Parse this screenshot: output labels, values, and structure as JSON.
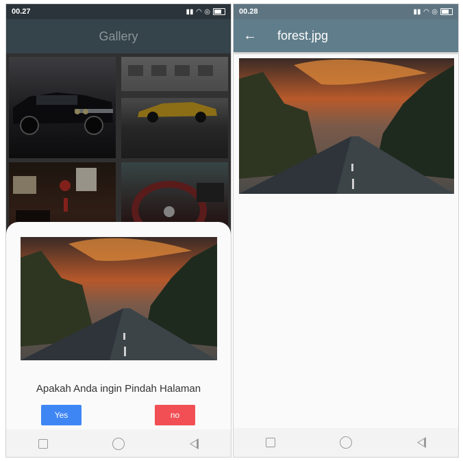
{
  "left_screen": {
    "status": {
      "time": "00.27"
    },
    "appbar": {
      "title": "Gallery"
    },
    "gallery": {
      "tiles": [
        {
          "name": "car-black"
        },
        {
          "name": "car-yellow"
        },
        {
          "name": "street-night"
        },
        {
          "name": "steering-wheel"
        }
      ]
    },
    "dialog": {
      "question": "Apakah Anda ingin Pindah Halaman",
      "yes_label": "Yes",
      "no_label": "no",
      "yes_color": "#3f86f5",
      "no_color": "#f24f55"
    }
  },
  "right_screen": {
    "status": {
      "time": "00.28"
    },
    "appbar": {
      "title": "forest.jpg",
      "back_icon": "arrow-left-icon"
    }
  },
  "colors": {
    "appbar_dim": "#35434a",
    "appbar_primary": "#607d8b",
    "background": "#fafafa"
  }
}
